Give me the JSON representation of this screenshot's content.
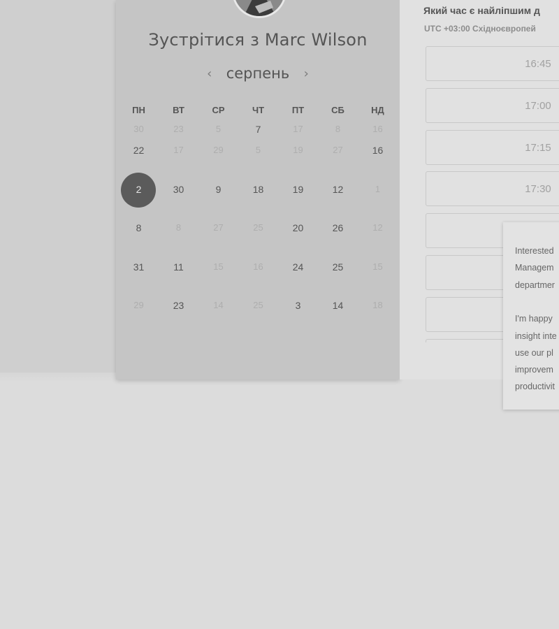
{
  "colors": {
    "background": "#dcdcdc",
    "card": "#c5c5c5",
    "selected_day": "#5b5b5b",
    "times_panel": "#e1e1e1"
  },
  "host": {
    "title": "Зустрітися з Marc Wilson",
    "avatar_icon": "person-avatar-icon"
  },
  "calendar": {
    "month": "серпень",
    "prev_icon": "‹",
    "next_icon": "›",
    "weekdays": [
      "ПН",
      "ВТ",
      "СР",
      "ЧТ",
      "ПТ",
      "СБ",
      "НД"
    ],
    "weeks": [
      [
        {
          "d": "30",
          "m": true
        },
        {
          "d": "23",
          "m": true
        },
        {
          "d": "5",
          "m": true
        },
        {
          "d": "7",
          "m": false
        },
        {
          "d": "17",
          "m": true
        },
        {
          "d": "8",
          "m": true
        },
        {
          "d": "16",
          "m": true
        }
      ],
      [
        {
          "d": "22",
          "m": false
        },
        {
          "d": "17",
          "m": true
        },
        {
          "d": "29",
          "m": true
        },
        {
          "d": "5",
          "m": true
        },
        {
          "d": "19",
          "m": true
        },
        {
          "d": "27",
          "m": true
        },
        {
          "d": "16",
          "m": false
        }
      ],
      [
        {
          "d": "2",
          "m": false,
          "sel": true
        },
        {
          "d": "30",
          "m": false
        },
        {
          "d": "9",
          "m": false
        },
        {
          "d": "18",
          "m": false
        },
        {
          "d": "19",
          "m": false
        },
        {
          "d": "12",
          "m": false
        },
        {
          "d": "1",
          "m": true
        }
      ],
      [
        {
          "d": "8",
          "m": false
        },
        {
          "d": "8",
          "m": true
        },
        {
          "d": "27",
          "m": true
        },
        {
          "d": "25",
          "m": true
        },
        {
          "d": "20",
          "m": false
        },
        {
          "d": "26",
          "m": false
        },
        {
          "d": "12",
          "m": true
        }
      ],
      [
        {
          "d": "31",
          "m": false
        },
        {
          "d": "11",
          "m": false
        },
        {
          "d": "15",
          "m": true
        },
        {
          "d": "16",
          "m": true
        },
        {
          "d": "24",
          "m": false
        },
        {
          "d": "25",
          "m": false
        },
        {
          "d": "15",
          "m": true
        }
      ],
      [
        {
          "d": "29",
          "m": true
        },
        {
          "d": "23",
          "m": false
        },
        {
          "d": "14",
          "m": true
        },
        {
          "d": "25",
          "m": true
        },
        {
          "d": "3",
          "m": false
        },
        {
          "d": "14",
          "m": false
        },
        {
          "d": "18",
          "m": true
        }
      ]
    ]
  },
  "times": {
    "question": "Який час є найліпшим д",
    "timezone": "UTC +03:00 Східноєвропей",
    "slots": [
      "16:45",
      "17:00",
      "17:15",
      "17:30",
      "",
      "",
      "",
      ""
    ]
  },
  "tooltip": {
    "lines": [
      "Interested",
      "Managem",
      "departmer",
      "",
      "I'm happy",
      "insight inte",
      "use our pl",
      "improvem",
      "productivit"
    ]
  }
}
